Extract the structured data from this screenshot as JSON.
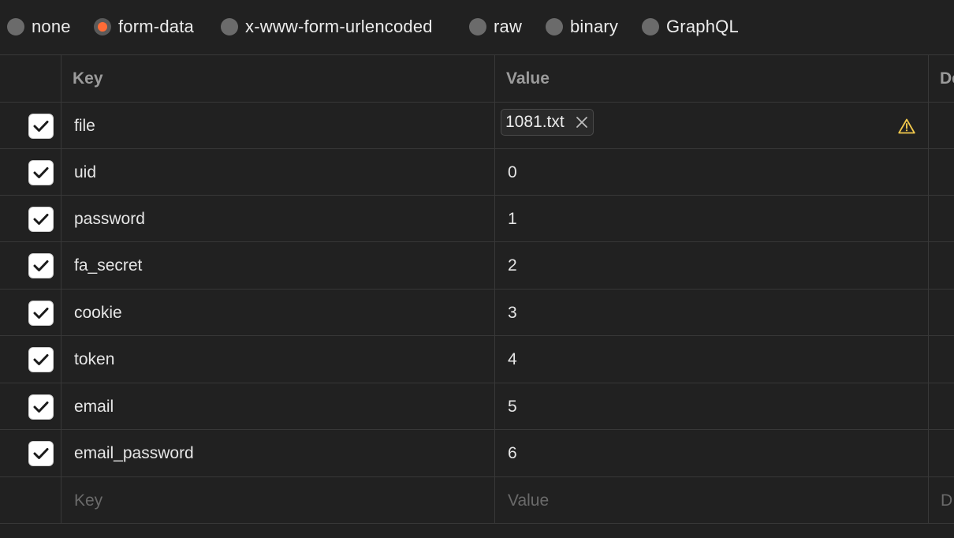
{
  "body_types": {
    "selected": "form-data",
    "options": [
      {
        "id": "none",
        "label": "none"
      },
      {
        "id": "form-data",
        "label": "form-data"
      },
      {
        "id": "urlencoded",
        "label": "x-www-form-urlencoded"
      },
      {
        "id": "raw",
        "label": "raw"
      },
      {
        "id": "binary",
        "label": "binary"
      },
      {
        "id": "graphql",
        "label": "GraphQL"
      }
    ]
  },
  "table": {
    "headers": {
      "key": "Key",
      "value": "Value",
      "description": "De"
    },
    "rows": [
      {
        "key": "file",
        "value": "1081.txt",
        "type": "file",
        "checked": true,
        "warning_icon": "warning-icon"
      },
      {
        "key": "uid",
        "value": "0",
        "checked": true
      },
      {
        "key": "password",
        "value": "1",
        "checked": true
      },
      {
        "key": "fa_secret",
        "value": "2",
        "checked": true
      },
      {
        "key": "cookie",
        "value": "3",
        "checked": true
      },
      {
        "key": "token",
        "value": "4",
        "checked": true
      },
      {
        "key": "email",
        "value": "5",
        "checked": true
      },
      {
        "key": "email_password",
        "value": "6",
        "checked": true
      }
    ],
    "new_row": {
      "key_placeholder": "Key",
      "value_placeholder": "Value",
      "description_placeholder": "D"
    }
  },
  "colors": {
    "background": "#212121",
    "accent": "#ff6c37",
    "border": "#383838",
    "warning": "#f2c94c"
  }
}
